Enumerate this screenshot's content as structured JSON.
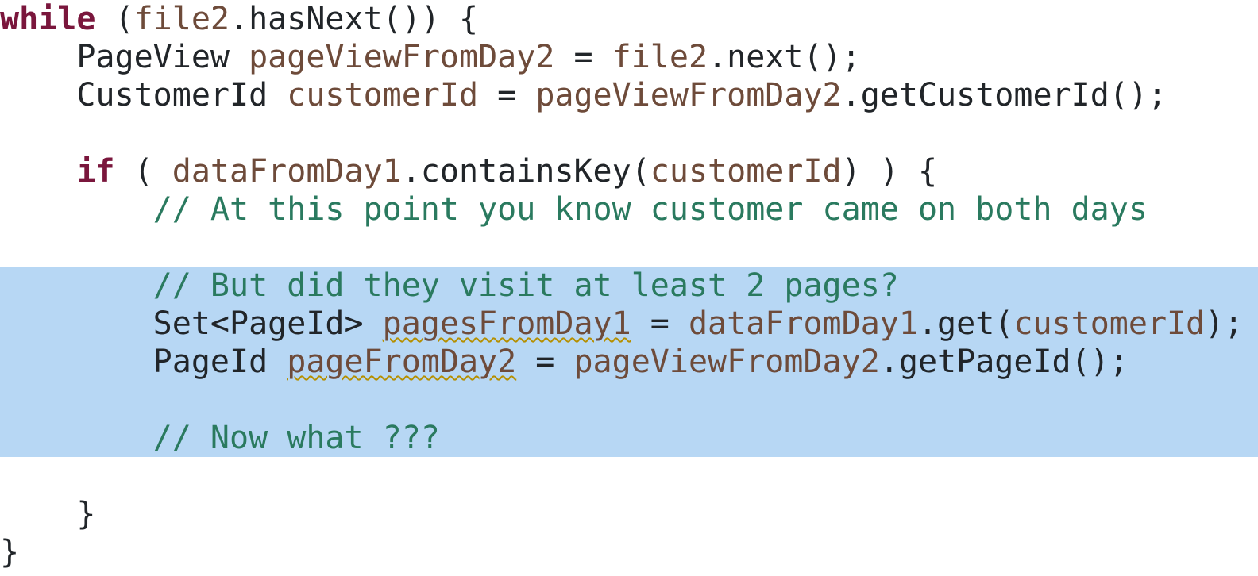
{
  "code": {
    "lines": [
      {
        "hl": false,
        "segs": [
          {
            "cls": "kw",
            "t": "while"
          },
          {
            "cls": "plain",
            "t": " ("
          },
          {
            "cls": "id",
            "t": "file2"
          },
          {
            "cls": "plain",
            "t": ".hasNext()) {"
          }
        ]
      },
      {
        "hl": false,
        "segs": [
          {
            "cls": "plain",
            "t": "    PageView "
          },
          {
            "cls": "id",
            "t": "pageViewFromDay2"
          },
          {
            "cls": "plain",
            "t": " = "
          },
          {
            "cls": "id",
            "t": "file2"
          },
          {
            "cls": "plain",
            "t": ".next();"
          }
        ]
      },
      {
        "hl": false,
        "segs": [
          {
            "cls": "plain",
            "t": "    CustomerId "
          },
          {
            "cls": "id",
            "t": "customerId"
          },
          {
            "cls": "plain",
            "t": " = "
          },
          {
            "cls": "id",
            "t": "pageViewFromDay2"
          },
          {
            "cls": "plain",
            "t": ".getCustomerId();"
          }
        ]
      },
      {
        "hl": false,
        "segs": [
          {
            "cls": "plain",
            "t": " "
          }
        ]
      },
      {
        "hl": false,
        "segs": [
          {
            "cls": "plain",
            "t": "    "
          },
          {
            "cls": "kw",
            "t": "if"
          },
          {
            "cls": "plain",
            "t": " ( "
          },
          {
            "cls": "id",
            "t": "dataFromDay1"
          },
          {
            "cls": "plain",
            "t": ".containsKey("
          },
          {
            "cls": "id",
            "t": "customerId"
          },
          {
            "cls": "plain",
            "t": ") ) {"
          }
        ]
      },
      {
        "hl": false,
        "segs": [
          {
            "cls": "plain",
            "t": "        "
          },
          {
            "cls": "cmt",
            "t": "// At this point you know customer came on both days"
          }
        ]
      },
      {
        "hl": false,
        "segs": [
          {
            "cls": "plain",
            "t": " "
          }
        ]
      },
      {
        "hl": true,
        "segs": [
          {
            "cls": "plain",
            "t": "        "
          },
          {
            "cls": "cmt",
            "t": "// But did they visit at least 2 pages?"
          }
        ]
      },
      {
        "hl": true,
        "segs": [
          {
            "cls": "plain",
            "t": "        Set<PageId> "
          },
          {
            "cls": "id wavy",
            "t": "pagesFromDay1"
          },
          {
            "cls": "plain",
            "t": " = "
          },
          {
            "cls": "id",
            "t": "dataFromDay1"
          },
          {
            "cls": "plain",
            "t": ".get("
          },
          {
            "cls": "id",
            "t": "customerId"
          },
          {
            "cls": "plain",
            "t": ");"
          }
        ]
      },
      {
        "hl": true,
        "segs": [
          {
            "cls": "plain",
            "t": "        PageId "
          },
          {
            "cls": "id wavy",
            "t": "pageFromDay2"
          },
          {
            "cls": "plain",
            "t": " = "
          },
          {
            "cls": "id",
            "t": "pageViewFromDay2"
          },
          {
            "cls": "plain",
            "t": ".getPageId();"
          }
        ]
      },
      {
        "hl": true,
        "segs": [
          {
            "cls": "plain",
            "t": " "
          }
        ]
      },
      {
        "hl": true,
        "segs": [
          {
            "cls": "plain",
            "t": "        "
          },
          {
            "cls": "cmt",
            "t": "// Now what ???"
          }
        ]
      },
      {
        "hl": false,
        "segs": [
          {
            "cls": "plain",
            "t": " "
          }
        ]
      },
      {
        "hl": false,
        "segs": [
          {
            "cls": "plain",
            "t": "    }"
          }
        ]
      },
      {
        "hl": false,
        "segs": [
          {
            "cls": "plain",
            "t": "}"
          }
        ]
      }
    ]
  }
}
